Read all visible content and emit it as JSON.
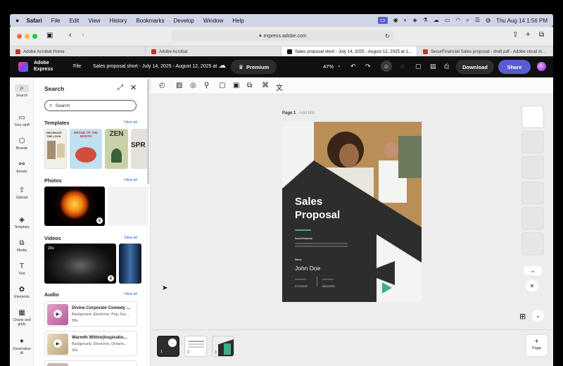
{
  "macos_menubar": {
    "apple_icon": "apple-icon",
    "app_name": "Safari",
    "menus": [
      "File",
      "Edit",
      "View",
      "History",
      "Bookmarks",
      "Develop",
      "Window",
      "Help"
    ],
    "datetime": "Thu Aug 14  1:56 PM"
  },
  "browser": {
    "address": "express.adobe.com",
    "tabs": [
      {
        "label": "Adobe Acrobat Home",
        "active": false
      },
      {
        "label": "Adobe Acrobat",
        "active": false
      },
      {
        "label": "Sales proposal short - July 14, 2025 - August 12, 2025 at 1...",
        "active": true
      },
      {
        "label": "SecurFinancial Sales proposal - draft.pdf - Adobe cloud st...",
        "active": false
      }
    ]
  },
  "app_header": {
    "brand_line1": "Adobe",
    "brand_line2": "Express",
    "file_menu": "File",
    "doc_title": "Sales proposal short - July 14, 2025 - August 12, 2025 at ...",
    "premium_label": "Premium",
    "zoom": "47%",
    "download_label": "Download",
    "share_label": "Share",
    "share_color": "#5b5bd6"
  },
  "rail": {
    "items": [
      {
        "label": "Search",
        "icon": "search-icon"
      },
      {
        "label": "Your stuff",
        "icon": "folder-icon"
      },
      {
        "label": "Brands",
        "icon": "brand-icon"
      },
      {
        "label": "Assets",
        "icon": "assets-icon"
      },
      {
        "label": "Upload",
        "icon": "upload-icon"
      },
      {
        "label": "Template",
        "icon": "template-icon"
      },
      {
        "label": "Media",
        "icon": "media-icon"
      },
      {
        "label": "Text",
        "icon": "text-icon"
      },
      {
        "label": "Elements",
        "icon": "elements-icon"
      },
      {
        "label": "Charts and grids",
        "icon": "charts-icon"
      },
      {
        "label": "Generative AI",
        "icon": "generative-ai-icon"
      }
    ]
  },
  "panel": {
    "title": "Search",
    "search_placeholder": "Search",
    "templates_title": "Templates",
    "templates_viewall": "View all",
    "template_texts": [
      "RECREATE THE LOOK",
      "BRAND OF THE MONTH",
      "ZEN",
      "SPR"
    ],
    "photos_title": "Photos",
    "photos_viewall": "View all",
    "videos_title": "Videos",
    "videos_viewall": "View all",
    "video_duration": "20s",
    "audio_title": "Audio",
    "audio_viewall": "View all",
    "audio_items": [
      {
        "title": "Divine Corporate Comedy ...",
        "tags": "Background, Electronic, Pop, Fes...",
        "duration": "99s"
      },
      {
        "title": "Warmth Within(Inspiratio...",
        "tags": "Background, Electronic, Dynami...",
        "duration": "32s"
      }
    ]
  },
  "canvas": {
    "page_label": "Page 1",
    "page_title_placeholder": "- Add title",
    "doc": {
      "title_line1": "Sales",
      "title_line2": "Proposal",
      "accent_color": "#3fb08a",
      "company_label": "SecurFinancial",
      "name_label": "Name",
      "name_value": "John Doe",
      "date_start": "07/14/2025",
      "date_end": "08/12/2025"
    }
  },
  "pages_strip": {
    "page_numbers": [
      "1",
      "2",
      "3"
    ],
    "add_page_label": "Page"
  }
}
